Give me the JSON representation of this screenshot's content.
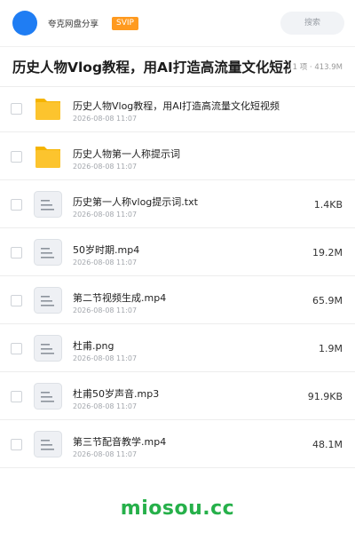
{
  "header": {
    "app_name": "夸克网盘分享",
    "badge": "SVIP",
    "search_placeholder": "搜索",
    "avatar_color": "#1f7df3",
    "badge_color": "#ff9a1f"
  },
  "title": {
    "text": "历史人物Vlog教程，用AI打造高流量文化短视频",
    "meta": "1 项 · 413.9M"
  },
  "files": [
    {
      "name": "历史人物Vlog教程，用AI打造高流量文化短视频",
      "date": "2026-08-08 11:07",
      "size": "",
      "icon": "folder-icon"
    },
    {
      "name": "历史人物第一人称提示词",
      "date": "2026-08-08 11:07",
      "size": "",
      "icon": "folder-icon"
    },
    {
      "name": "历史第一人称vlog提示词.txt",
      "date": "2026-08-08 11:07",
      "size": "1.4KB",
      "icon": "document-icon"
    },
    {
      "name": "50岁时期.mp4",
      "date": "2026-08-08 11:07",
      "size": "19.2M",
      "icon": "document-icon"
    },
    {
      "name": "第二节视频生成.mp4",
      "date": "2026-08-08 11:07",
      "size": "65.9M",
      "icon": "document-icon"
    },
    {
      "name": "杜甫.png",
      "date": "2026-08-08 11:07",
      "size": "1.9M",
      "icon": "document-icon"
    },
    {
      "name": "杜甫50岁声音.mp3",
      "date": "2026-08-08 11:07",
      "size": "91.9KB",
      "icon": "document-icon"
    },
    {
      "name": "第三节配音教学.mp4",
      "date": "2026-08-08 11:07",
      "size": "48.1M",
      "icon": "document-icon"
    }
  ],
  "watermark": "miosou.cc",
  "colors": {
    "folder": "#fcc42e",
    "folder_tab": "#f5b400",
    "doc_bg": "#eef0f4",
    "doc_line": "#8c939c",
    "watermark": "#26b04a"
  }
}
